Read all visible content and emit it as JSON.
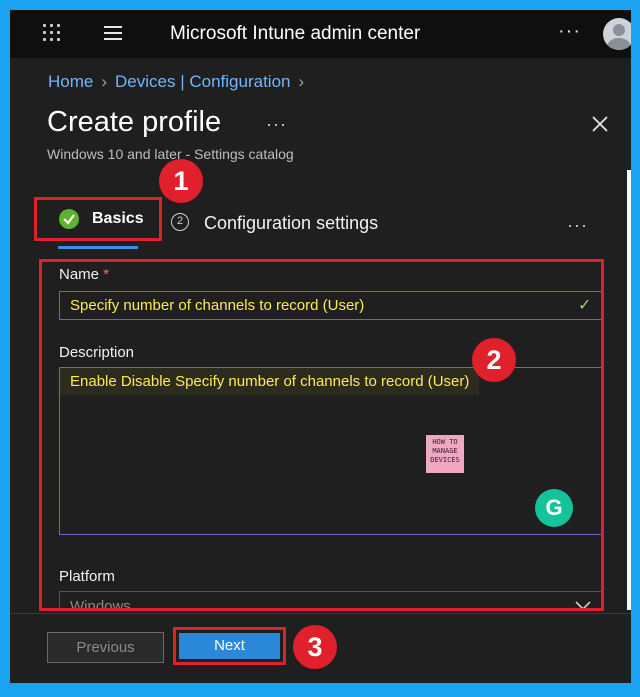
{
  "header": {
    "app_title": "Microsoft Intune admin center",
    "more": "···"
  },
  "breadcrumb": [
    "Home",
    "Devices | Configuration"
  ],
  "page": {
    "title": "Create profile",
    "subtitle": "Windows 10 and later - Settings catalog",
    "more": "···"
  },
  "steps": [
    {
      "number": "1",
      "label": "Basics",
      "state": "complete"
    },
    {
      "number": "2",
      "label": "Configuration settings",
      "state": "upcoming"
    }
  ],
  "steps_more": "···",
  "form": {
    "name_label": "Name",
    "required_mark": "*",
    "name_value": "Specify number of channels to record (User)",
    "description_label": "Description",
    "description_value": "Enable Disable Specify number of channels to record (User)",
    "platform_label": "Platform",
    "platform_value": "Windows"
  },
  "logo": {
    "lines": [
      "HOW TO",
      "MANAGE",
      "DEVICES"
    ]
  },
  "grammarly_icon": "G",
  "footer": {
    "previous_label": "Previous",
    "next_label": "Next"
  },
  "callouts": [
    "1",
    "2",
    "3"
  ],
  "colors": {
    "accent": "#2b88d8",
    "annotation": "#e0202a",
    "success": "#5db32b",
    "link": "#6fb6ff",
    "input_text": "#ffe95a"
  }
}
